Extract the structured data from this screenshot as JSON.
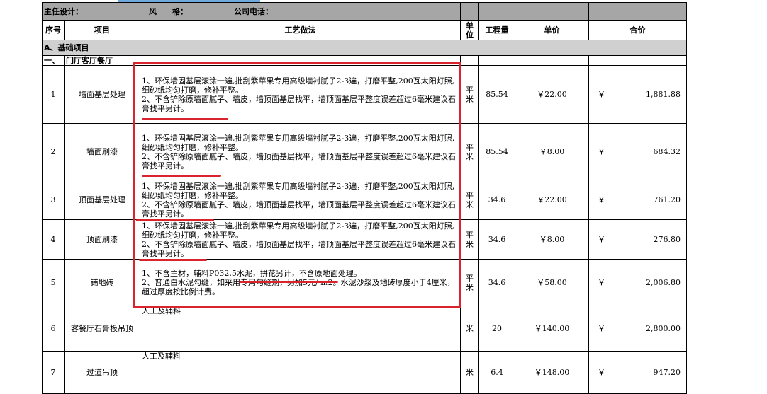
{
  "top_row": {
    "designer_label": "主任设计：",
    "style_label": "风　　格：",
    "phone_label": "公司电话："
  },
  "headers": {
    "no": "序号",
    "item": "项目",
    "process": "工艺做法",
    "unit": "单位",
    "quantity": "工程量",
    "unit_price": "单价",
    "total": "合价"
  },
  "section": {
    "title": "A、基础项目"
  },
  "subsection": {
    "no": "一、",
    "title": "门厅客厅餐厅"
  },
  "rows": [
    {
      "no": "1",
      "item": "墙面基层处理",
      "process": "1、环保墙固基层滚涂一遍,批刮紫苹果专用高级墙衬腻子2-3遍，打磨平整,200瓦太阳灯照,细砂纸均匀打磨，修补平整。\n2、不含铲除原墙面腻子、墙皮，墙顶面基层找平，墙顶面基层平整度误差超过6毫米建议石膏找平另计。",
      "unit": "平米",
      "quantity": "85.54",
      "unit_price": "￥22.00",
      "currency": "￥",
      "total": "1,881.88"
    },
    {
      "no": "2",
      "item": "墙面刷漆",
      "process": "1、环保墙固基层滚涂一遍,批刮紫苹果专用高级墙衬腻子2-3遍，打磨平整,200瓦太阳灯照,细砂纸均匀打磨，修补平整。\n2、不含铲除原墙面腻子、墙皮，墙顶面基层找平，墙顶面基层平整度误差超过6毫米建议石膏找平另计。",
      "unit": "平米",
      "quantity": "85.54",
      "unit_price": "￥8.00",
      "currency": "￥",
      "total": "684.32"
    },
    {
      "no": "3",
      "item": "顶面基层处理",
      "process": "1、环保墙固基层滚涂一遍,批刮紫苹果专用高级墙衬腻子2-3遍，打磨平整,200瓦太阳灯照,细砂纸均匀打磨，修补平整。\n2、不含铲除原墙面腻子、墙皮，墙顶面基层找平，墙顶面基层平整度误差超过6毫米建议石膏找平另计。",
      "unit": "平米",
      "quantity": "34.6",
      "unit_price": "￥22.00",
      "currency": "￥",
      "total": "761.20"
    },
    {
      "no": "4",
      "item": "顶面刷漆",
      "process": "1、环保墙固基层滚涂一遍,批刮紫苹果专用高级墙衬腻子2-3遍，打磨平整,200瓦太阳灯照,细砂纸均匀打磨，修补平整。\n2、不含铲除原墙面腻子、墙皮，墙顶面基层找平，墙顶面基层平整度误差超过6毫米建议石膏找平另计。",
      "unit": "平米",
      "quantity": "34.6",
      "unit_price": "￥8.00",
      "currency": "￥",
      "total": "276.80"
    },
    {
      "no": "5",
      "item": "铺地砖",
      "process": "1、不含主材，辅料P032.5水泥，拼花另计，不含原地面处理。\n2、普通白水泥勾缝，如采用专用勾缝剂，另加5元/ m2。水泥沙浆及地砖厚度小于4厘米，超过厚度按比例计费。",
      "unit": "平米",
      "quantity": "34.6",
      "unit_price": "￥58.00",
      "currency": "￥",
      "total": "2,006.80"
    },
    {
      "no": "6",
      "item": "客餐厅石膏板吊顶",
      "process": "人工及辅料",
      "unit": "米",
      "quantity": "20",
      "unit_price": "￥140.00",
      "currency": "￥",
      "total": "2,800.00"
    },
    {
      "no": "7",
      "item": "过道吊顶",
      "process": "人工及辅料",
      "unit": "米",
      "quantity": "6.4",
      "unit_price": "￥148.00",
      "currency": "￥",
      "total": "947.20"
    }
  ],
  "annotation_color": "#d9232d"
}
